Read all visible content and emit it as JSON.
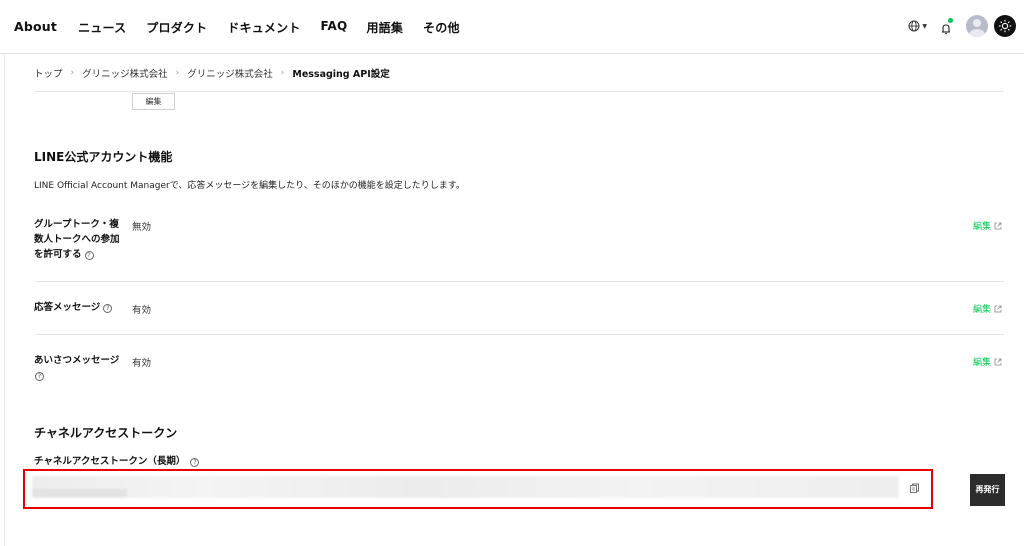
{
  "nav": {
    "items": [
      "About",
      "ニュース",
      "プロダクト",
      "ドキュメント",
      "FAQ",
      "用語集",
      "その他"
    ]
  },
  "header": {
    "globe_icon": "globe-icon",
    "notification_icon": "bell-icon",
    "avatar_icon": "user-avatar",
    "theme_icon": "sun-icon",
    "accent_color": "#06c755"
  },
  "breadcrumb": {
    "items": [
      "トップ",
      "グリニッジ株式会社",
      "グリニッジ株式会社",
      "Messaging API設定"
    ]
  },
  "top_edit_label": "編集",
  "line_oa": {
    "title": "LINE公式アカウント機能",
    "description": "LINE Official Account Managerで、応答メッセージを編集したり、そのほかの機能を設定したりします。",
    "rows": [
      {
        "label_lines": [
          "グループトーク・複",
          "数人トークへの参加",
          "を許可する"
        ],
        "value": "無効",
        "edit_label": "編集"
      },
      {
        "label_lines": [
          "応答メッセージ"
        ],
        "value": "有効",
        "edit_label": "編集"
      },
      {
        "label_lines": [
          "あいさつメッセージ"
        ],
        "value": "有効",
        "edit_label": "編集"
      }
    ]
  },
  "token": {
    "title": "チャネルアクセストークン",
    "label": "チャネルアクセストークン（長期）",
    "reissue_label": "再発行",
    "highlight_color": "#e60000"
  },
  "help_glyph": "?"
}
